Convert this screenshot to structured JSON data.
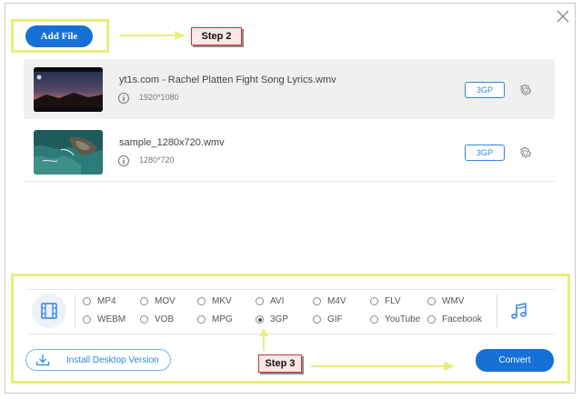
{
  "header": {
    "add_file_label": "Add File",
    "step2_label": "Step 2",
    "close_icon": "close-icon"
  },
  "files": [
    {
      "name": "yt1s.com - Rachel Platten Fight Song Lyrics.wmv",
      "resolution": "1920*1080",
      "format": "3GP",
      "thumbnail": "sunset-landscape"
    },
    {
      "name": "sample_1280x720.wmv",
      "resolution": "1280*720",
      "format": "3GP",
      "thumbnail": "coastal-aerial"
    }
  ],
  "formats": {
    "video_icon": "film-icon",
    "audio_icon": "music-note-icon",
    "options": [
      "MP4",
      "MOV",
      "MKV",
      "AVI",
      "M4V",
      "FLV",
      "WMV",
      "WEBM",
      "VOB",
      "MPG",
      "3GP",
      "GIF",
      "YouTube",
      "Facebook"
    ],
    "selected": "3GP"
  },
  "footer": {
    "install_label": "Install Desktop Version",
    "step3_label": "Step 3",
    "convert_label": "Convert"
  },
  "colors": {
    "accent": "#1670d6",
    "highlight": "#e6ef7a",
    "step_bg": "#fde7e7",
    "step_border": "#cc3333"
  }
}
